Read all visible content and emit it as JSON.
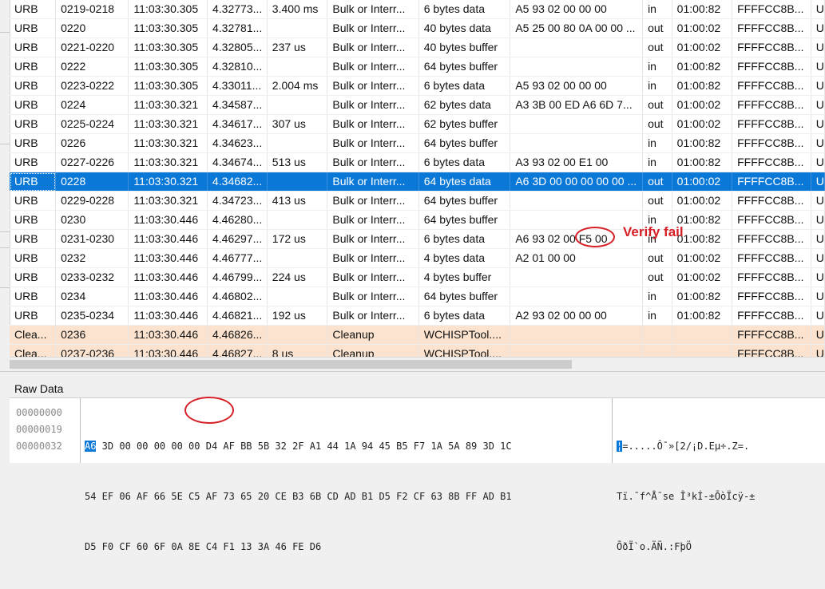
{
  "trace": {
    "rows": [
      {
        "cells": [
          "URB",
          "0219-0218",
          "11:03:30.305",
          "4.32773...",
          "3.400 ms",
          "Bulk or Interr...",
          "6 bytes data",
          "A5 93 02 00 00 00",
          "in",
          "01:00:82",
          "FFFFCC8B...",
          "U"
        ]
      },
      {
        "cells": [
          "URB",
          "0220",
          "11:03:30.305",
          "4.32781...",
          "",
          "Bulk or Interr...",
          "40 bytes data",
          "A5 25 00 80 0A 00 00 ...",
          "out",
          "01:00:02",
          "FFFFCC8B...",
          "U"
        ]
      },
      {
        "cells": [
          "URB",
          "0221-0220",
          "11:03:30.305",
          "4.32805...",
          "237 us",
          "Bulk or Interr...",
          "40 bytes buffer",
          "",
          "out",
          "01:00:02",
          "FFFFCC8B...",
          "U"
        ]
      },
      {
        "cells": [
          "URB",
          "0222",
          "11:03:30.305",
          "4.32810...",
          "",
          "Bulk or Interr...",
          "64 bytes buffer",
          "",
          "in",
          "01:00:82",
          "FFFFCC8B...",
          "U"
        ]
      },
      {
        "cells": [
          "URB",
          "0223-0222",
          "11:03:30.305",
          "4.33011...",
          "2.004 ms",
          "Bulk or Interr...",
          "6 bytes data",
          "A5 93 02 00 00 00",
          "in",
          "01:00:82",
          "FFFFCC8B...",
          "U"
        ]
      },
      {
        "cells": [
          "URB",
          "0224",
          "11:03:30.321",
          "4.34587...",
          "",
          "Bulk or Interr...",
          "62 bytes data",
          "A3 3B 00 ED A6 6D 7...",
          "out",
          "01:00:02",
          "FFFFCC8B...",
          "U"
        ]
      },
      {
        "cells": [
          "URB",
          "0225-0224",
          "11:03:30.321",
          "4.34617...",
          "307 us",
          "Bulk or Interr...",
          "62 bytes buffer",
          "",
          "out",
          "01:00:02",
          "FFFFCC8B...",
          "U"
        ]
      },
      {
        "cells": [
          "URB",
          "0226",
          "11:03:30.321",
          "4.34623...",
          "",
          "Bulk or Interr...",
          "64 bytes buffer",
          "",
          "in",
          "01:00:82",
          "FFFFCC8B...",
          "U"
        ]
      },
      {
        "cells": [
          "URB",
          "0227-0226",
          "11:03:30.321",
          "4.34674...",
          "513 us",
          "Bulk or Interr...",
          "6 bytes data",
          "A3 93 02 00 E1 00",
          "in",
          "01:00:82",
          "FFFFCC8B...",
          "U"
        ]
      },
      {
        "cells": [
          "URB",
          "0228",
          "11:03:30.321",
          "4.34682...",
          "",
          "Bulk or Interr...",
          "64 bytes data",
          "A6 3D 00 00 00 00 00 ...",
          "out",
          "01:00:02",
          "FFFFCC8B...",
          "U"
        ],
        "selected": true
      },
      {
        "cells": [
          "URB",
          "0229-0228",
          "11:03:30.321",
          "4.34723...",
          "413 us",
          "Bulk or Interr...",
          "64 bytes buffer",
          "",
          "out",
          "01:00:02",
          "FFFFCC8B...",
          "U"
        ]
      },
      {
        "cells": [
          "URB",
          "0230",
          "11:03:30.446",
          "4.46280...",
          "",
          "Bulk or Interr...",
          "64 bytes buffer",
          "",
          "in",
          "01:00:82",
          "FFFFCC8B...",
          "U"
        ]
      },
      {
        "cells": [
          "URB",
          "0231-0230",
          "11:03:30.446",
          "4.46297...",
          "172 us",
          "Bulk or Interr...",
          "6 bytes data",
          "A6 93 02 00 F5 00",
          "in",
          "01:00:82",
          "FFFFCC8B...",
          "U"
        ]
      },
      {
        "cells": [
          "URB",
          "0232",
          "11:03:30.446",
          "4.46777...",
          "",
          "Bulk or Interr...",
          "4 bytes data",
          "A2 01 00 00",
          "out",
          "01:00:02",
          "FFFFCC8B...",
          "U"
        ]
      },
      {
        "cells": [
          "URB",
          "0233-0232",
          "11:03:30.446",
          "4.46799...",
          "224 us",
          "Bulk or Interr...",
          "4 bytes buffer",
          "",
          "out",
          "01:00:02",
          "FFFFCC8B...",
          "U"
        ]
      },
      {
        "cells": [
          "URB",
          "0234",
          "11:03:30.446",
          "4.46802...",
          "",
          "Bulk or Interr...",
          "64 bytes buffer",
          "",
          "in",
          "01:00:82",
          "FFFFCC8B...",
          "U"
        ]
      },
      {
        "cells": [
          "URB",
          "0235-0234",
          "11:03:30.446",
          "4.46821...",
          "192 us",
          "Bulk or Interr...",
          "6 bytes data",
          "A2 93 02 00 00 00",
          "in",
          "01:00:82",
          "FFFFCC8B...",
          "U"
        ]
      },
      {
        "cells": [
          "Clea...",
          "0236",
          "11:03:30.446",
          "4.46826...",
          "",
          "Cleanup",
          "WCHISPTool....",
          "",
          "",
          "",
          "FFFFCC8B...",
          "U"
        ],
        "cleanup": true
      },
      {
        "cells": [
          "Clea...",
          "0237-0236",
          "11:03:30.446",
          "4.46827...",
          "8 us",
          "Cleanup",
          "WCHISPTool....",
          "",
          "",
          "",
          "FFFFCC8B...",
          "U"
        ],
        "cleanup": true
      }
    ]
  },
  "annotation": {
    "text": "Verify fail",
    "color": "#d61f26"
  },
  "raw_data": {
    "title": "Raw Data",
    "offsets": [
      "00000000",
      "00000019",
      "00000032"
    ],
    "hex_first_selected": "A6",
    "hex_line1_rest": " 3D 00 00 00 00 00 D4 AF BB 5B 32 2F A1 44 1A 94 45 B5 F7 1A 5A 89 3D 1C",
    "hex_line2": "54 EF 06 AF 66 5E C5 AF 73 65 20 CE B3 6B CD AD B1 D5 F2 CF 63 8B FF AD B1",
    "hex_line3": "D5 F0 CF 60 6F 0A 8E C4 F1 13 3A 46 FE D6",
    "ascii_first_selected": "¦",
    "ascii_line1_rest": "=.....Ô¯»[2/¡D.Eµ÷.Z=.",
    "ascii_line2": "Tï.¯f^Å¯se Î³kÍ-±ÕòÏcÿ-±",
    "ascii_line3": "ÕðÏ`o.ÄÑ.:FþÖ"
  },
  "colors": {
    "selection": "#0a78d7",
    "cleanup_row": "#fbe3cf",
    "callout": "#d61f26"
  }
}
